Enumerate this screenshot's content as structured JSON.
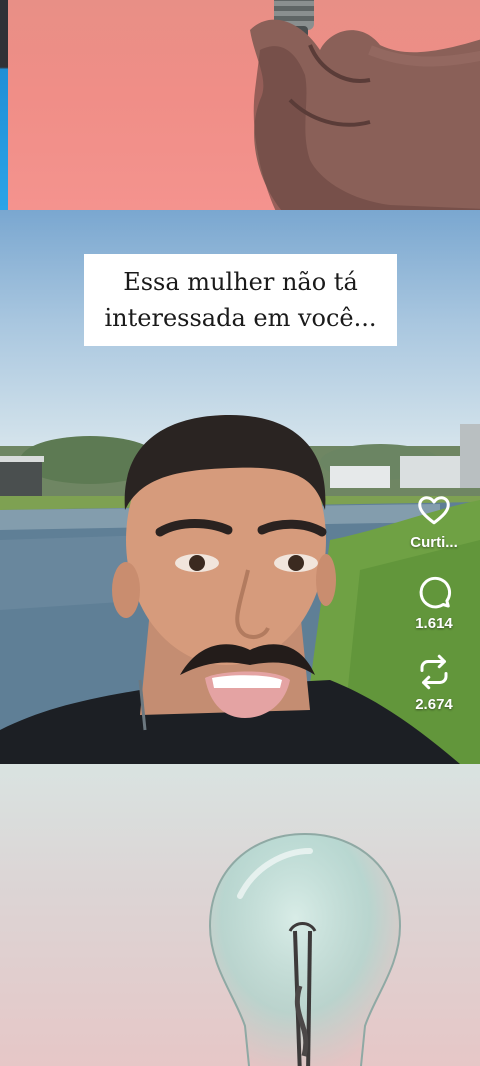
{
  "feed": {
    "main_post": {
      "caption_line1": "Essa mulher não tá",
      "caption_line2": "interessada em você...",
      "actions": {
        "like_label": "Curti...",
        "comment_count": "1.614",
        "share_count": "2.674"
      }
    }
  },
  "icons": {
    "like": "heart-icon",
    "comment": "comment-bubble-icon",
    "share": "repost-icon"
  },
  "colors": {
    "caption_bg": "#ffffff",
    "action_text": "#ffffff",
    "top_post_bg": "#f08e87"
  }
}
